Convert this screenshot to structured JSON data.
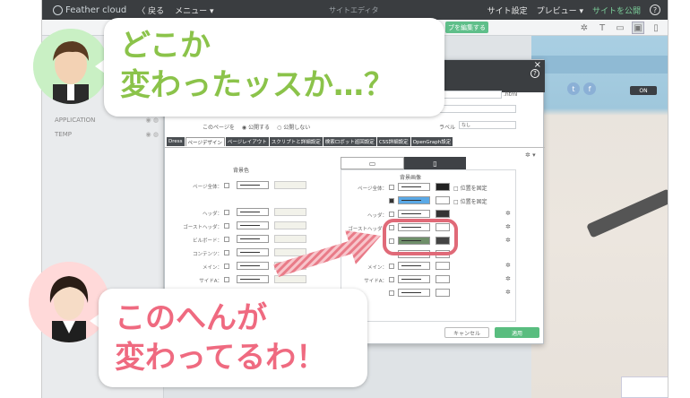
{
  "topbar": {
    "logo": "Feather cloud",
    "back": "〈 戻る",
    "menu": "メニュー ▾",
    "center": "サイトエディタ",
    "site_settings": "サイト設定",
    "preview": "プレビュー ▾",
    "publish": "サイトを公開",
    "help": "?"
  },
  "toolbar": {
    "edit_button": "ブを編集する"
  },
  "sidepanel": {
    "items": [
      {
        "label": "APPLICATION"
      },
      {
        "label": "TEMP"
      }
    ]
  },
  "preview": {
    "on_label": "ON"
  },
  "modal": {
    "html_suffix": ".html",
    "radio_label": "このページを",
    "radio_public": "公開する",
    "radio_private": "公開しない",
    "label_field": "ラベル",
    "label_value": "なし",
    "tabs": [
      {
        "label": "Dress",
        "active": false
      },
      {
        "label": "ページデザイン",
        "active": true
      },
      {
        "label": "ページレイアウト",
        "active": false
      },
      {
        "label": "スクリプトと詳細設定",
        "active": false
      },
      {
        "label": "検索ロボット巡回設定",
        "active": false
      },
      {
        "label": "CSS詳細設定",
        "active": false
      },
      {
        "label": "OpenGraph設定",
        "active": false
      }
    ],
    "left_header": "背景色",
    "right_header": "背景画像",
    "left_rows": [
      "ページ全体：",
      "ヘッダ：",
      "ゴーストヘッダ：",
      "ビルボード：",
      "コンテンツ：",
      "メイン：",
      "サイドA："
    ],
    "right_rows": [
      "ページ全体：",
      "",
      "ヘッダ：",
      "ゴーストヘッダ：",
      "ビルボード：",
      "",
      "メイン：",
      "サイドA："
    ],
    "fix_position": "位置を固定",
    "cancel": "キャンセル",
    "apply": "適用"
  },
  "callouts": {
    "top_line1": "どこか",
    "top_line2": "変わったッスか…？",
    "bottom_line1": "このへんが",
    "bottom_line2": "変わってるわ！"
  },
  "colors": {
    "accent_green": "#5fbf8a",
    "highlight_ring": "#e06a78",
    "callout_green": "#8bc34a",
    "callout_pink": "#ef6a80"
  }
}
